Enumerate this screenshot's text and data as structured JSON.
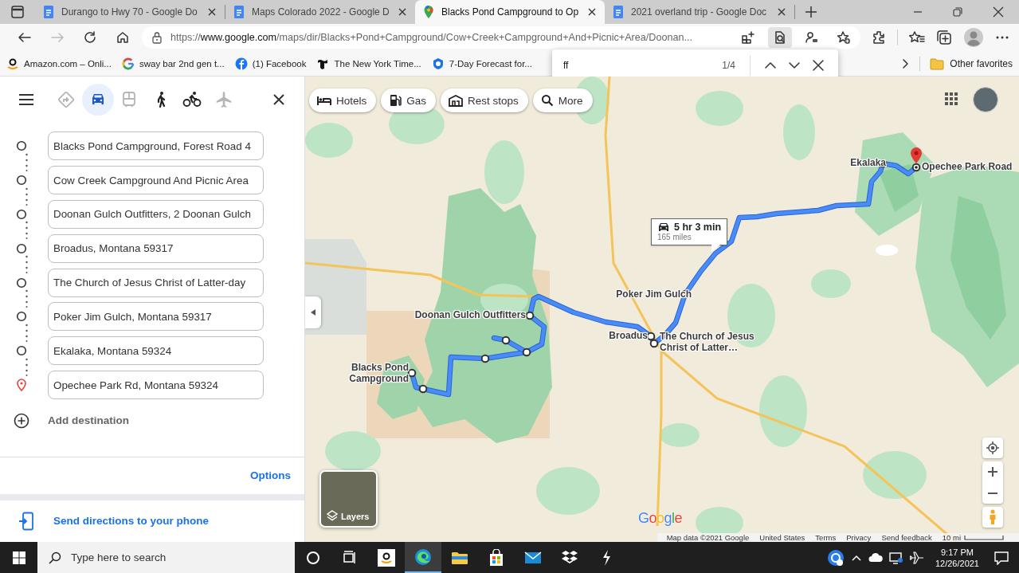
{
  "browser": {
    "tabs": [
      {
        "title": "Durango to Hwy 70 - Google Do",
        "kind": "docs",
        "selected": false
      },
      {
        "title": "Maps Colorado 2022 - Google D",
        "kind": "docs",
        "selected": false
      },
      {
        "title": "Blacks Pond Campground to Op",
        "kind": "maps",
        "selected": true
      },
      {
        "title": "2021 overland trip - Google Doc",
        "kind": "docs",
        "selected": false
      }
    ],
    "address": {
      "scheme": "https://",
      "host": "www.google.com",
      "path": "/maps/dir/Blacks+Pond+Campground/Cow+Creek+Campground+And+Picnic+Area/Doonan..."
    },
    "bookmarks": [
      {
        "label": "Amazon.com – Onli...",
        "kind": "amazon"
      },
      {
        "label": "sway bar 2nd gen t...",
        "kind": "google"
      },
      {
        "label": "(1) Facebook",
        "kind": "facebook"
      },
      {
        "label": "The New York Time...",
        "kind": "newspaper"
      },
      {
        "label": "7-Day Forecast for...",
        "kind": "weather"
      }
    ],
    "other_favorites": "Other favorites",
    "find_bar": {
      "query": "ff",
      "count": "1/4"
    }
  },
  "directions": {
    "travel_modes": [
      {
        "kind": "best",
        "selected": false,
        "disabled": true
      },
      {
        "kind": "driving",
        "selected": true,
        "disabled": false
      },
      {
        "kind": "transit",
        "selected": false,
        "disabled": true
      },
      {
        "kind": "walking",
        "selected": false,
        "disabled": false
      },
      {
        "kind": "cycling",
        "selected": false,
        "disabled": false
      },
      {
        "kind": "flights",
        "selected": false,
        "disabled": true
      }
    ],
    "stops": [
      {
        "value": "Blacks Pond Campground, Forest Road 4",
        "kind": "waypoint"
      },
      {
        "value": "Cow Creek Campground And Picnic Area",
        "kind": "waypoint"
      },
      {
        "value": "Doonan Gulch Outfitters, 2 Doonan Gulch",
        "kind": "waypoint"
      },
      {
        "value": "Broadus, Montana 59317",
        "kind": "waypoint"
      },
      {
        "value": "The Church of Jesus Christ of Latter-day",
        "kind": "waypoint"
      },
      {
        "value": "Poker Jim Gulch, Montana 59317",
        "kind": "waypoint"
      },
      {
        "value": "Ekalaka, Montana 59324",
        "kind": "waypoint"
      },
      {
        "value": "Opechee Park Rd, Montana 59324",
        "kind": "destination"
      }
    ],
    "add_destination": "Add destination",
    "options": "Options",
    "send_to_phone": "Send directions to your phone"
  },
  "map": {
    "chips": [
      {
        "label": "Hotels",
        "kind": "bed"
      },
      {
        "label": "Gas",
        "kind": "gas"
      },
      {
        "label": "Rest stops",
        "kind": "rest"
      },
      {
        "label": "More",
        "kind": "search"
      }
    ],
    "places": [
      "Blacks Pond Campground",
      "Doonan Gulch Outfitters",
      "Broadus",
      "The Church of Jesus Christ of Latter…",
      "Poker Jim Gulch",
      "Ekalaka",
      "Opechee Park Road"
    ],
    "trip": {
      "duration": "5 hr 3 min",
      "distance": "165 miles"
    },
    "layers": "Layers",
    "logo": "Google",
    "footer": [
      "Map data ©2021 Google",
      "United States",
      "Terms",
      "Privacy",
      "Send feedback"
    ],
    "scale": "10 mi"
  },
  "taskbar": {
    "search_placeholder": "Type here to search",
    "time": "9:17 PM",
    "date": "12/26/2021"
  }
}
